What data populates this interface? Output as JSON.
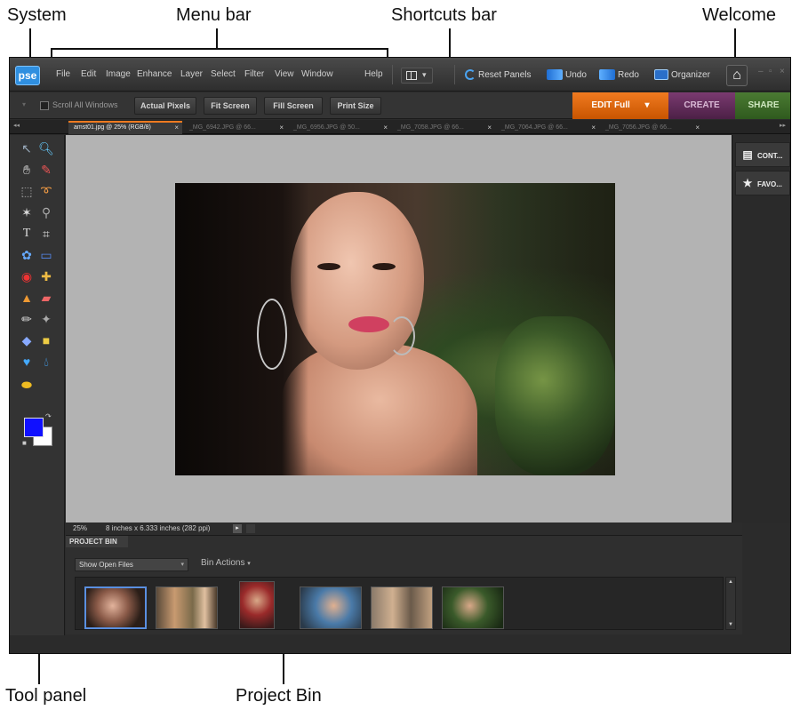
{
  "callouts": {
    "system": "System",
    "menu_bar": "Menu bar",
    "shortcuts_bar": "Shortcuts bar",
    "welcome": "Welcome",
    "tool_panel": "Tool panel",
    "project_bin": "Project Bin"
  },
  "app": {
    "logo": "pse",
    "menu": [
      "File",
      "Edit",
      "Image",
      "Enhance",
      "Layer",
      "Select",
      "Filter",
      "View",
      "Window",
      "Help"
    ],
    "toolbar": {
      "reset_panels": "Reset Panels",
      "undo": "Undo",
      "redo": "Redo",
      "organizer": "Organizer"
    },
    "shortcuts": {
      "scroll_all_windows": "Scroll All Windows",
      "actual_pixels": "Actual Pixels",
      "fit_screen": "Fit Screen",
      "fill_screen": "Fill Screen",
      "print_size": "Print Size"
    },
    "mode_tabs": {
      "edit": "EDIT Full",
      "create": "CREATE",
      "share": "SHARE"
    },
    "doc_tabs": [
      "amst01.jpg @ 25% (RGB/8)",
      "_MG_6942.JPG @ 66...",
      "_MG_6956.JPG @ 50...",
      "_MG_7058.JPG @ 66...",
      "_MG_7064.JPG @ 66...",
      "_MG_7056.JPG @ 66..."
    ],
    "status": {
      "zoom": "25%",
      "doc_size": "8 inches x 6.333 inches (282 ppi)"
    },
    "right_panel": {
      "content": "CONT...",
      "favorites": "FAVO..."
    },
    "project_bin": {
      "title": "PROJECT BIN",
      "show_select": "Show Open Files",
      "bin_actions": "Bin Actions"
    },
    "colors": {
      "foreground": "#1010ff",
      "background": "#ffffff",
      "edit_accent": "#f07a20",
      "create_accent": "#6a2e62",
      "share_accent": "#3f6b2a"
    }
  }
}
